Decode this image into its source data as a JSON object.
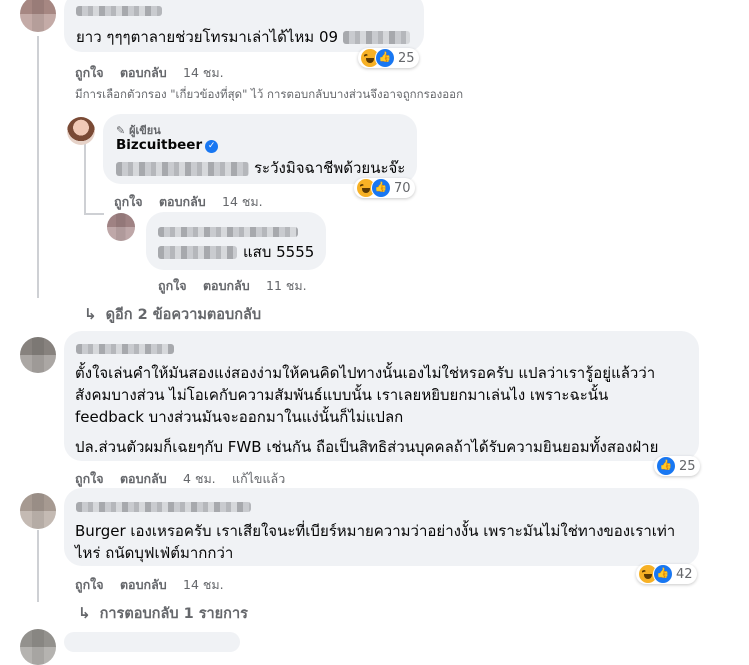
{
  "comments": [
    {
      "text": "ยาว ๆๆๆตาลายช่วยโทรมาเล่าได้ไหม 09",
      "actions": {
        "like": "ถูกใจ",
        "reply": "ตอบกลับ",
        "time": "14 ชม."
      },
      "reaction_count": "25"
    }
  ],
  "filter_note": "มีการเลือกตัวกรอง \"เกี่ยวข้องที่สุด\" ไว้ การตอบกลับบางส่วนจึงอาจถูกกรองออก",
  "author_reply": {
    "badge": "ผู้เขียน",
    "name": "Bizcuitbeer",
    "text": "ระวังมิจฉาชีพด้วยนะจ๊ะ",
    "actions": {
      "like": "ถูกใจ",
      "reply": "ตอบกลับ",
      "time": "14 ชม."
    },
    "reaction_count": "70"
  },
  "nested_reply": {
    "text": "แสบ 5555",
    "actions": {
      "like": "ถูกใจ",
      "reply": "ตอบกลับ",
      "time": "11 ชม."
    }
  },
  "see_more": "ดูอีก 2 ข้อความตอบกลับ",
  "comment2": {
    "lines": [
      "ตั้งใจเล่นคำให้มันสองแง่สองง่ามให้คนคิดไปทางนั้นเองไม่ใช่หรอครับ แปลว่าเรารู้อยู่แล้วว่า",
      "สังคมบางส่วน ไม่โอเคกับความสัมพันธ์แบบนั้น เราเลยหยิบยกมาเล่นไง เพราะฉะนั้น",
      "feedback บางส่วนมันจะออกมาในแง่นั้นก็ไม่แปลก"
    ],
    "line4": "ปล.ส่วนตัวผมก็เฉยๆกับ FWB เช่นกัน ถือเป็นสิทธิส่วนบุคคลถ้าได้รับความยินยอมทั้งสองฝ่าย",
    "actions": {
      "like": "ถูกใจ",
      "reply": "ตอบกลับ",
      "time": "4 ชม.",
      "edited": "แก้ไขแล้ว"
    },
    "reaction_count": "25"
  },
  "comment3": {
    "lines": [
      "Burger เองเหรอครับ เราเสียใจนะที่เบียร์หมายความว่าอย่างงั้น เพราะมันไม่ใช่ทางของเราเท่า",
      "ไหร่ ถนัดบุฟเฟ่ต์มากกว่า"
    ],
    "actions": {
      "like": "ถูกใจ",
      "reply": "ตอบกลับ",
      "time": "14 ชม."
    },
    "reaction_count": "42"
  },
  "replies_link": "การตอบกลับ 1 รายการ"
}
